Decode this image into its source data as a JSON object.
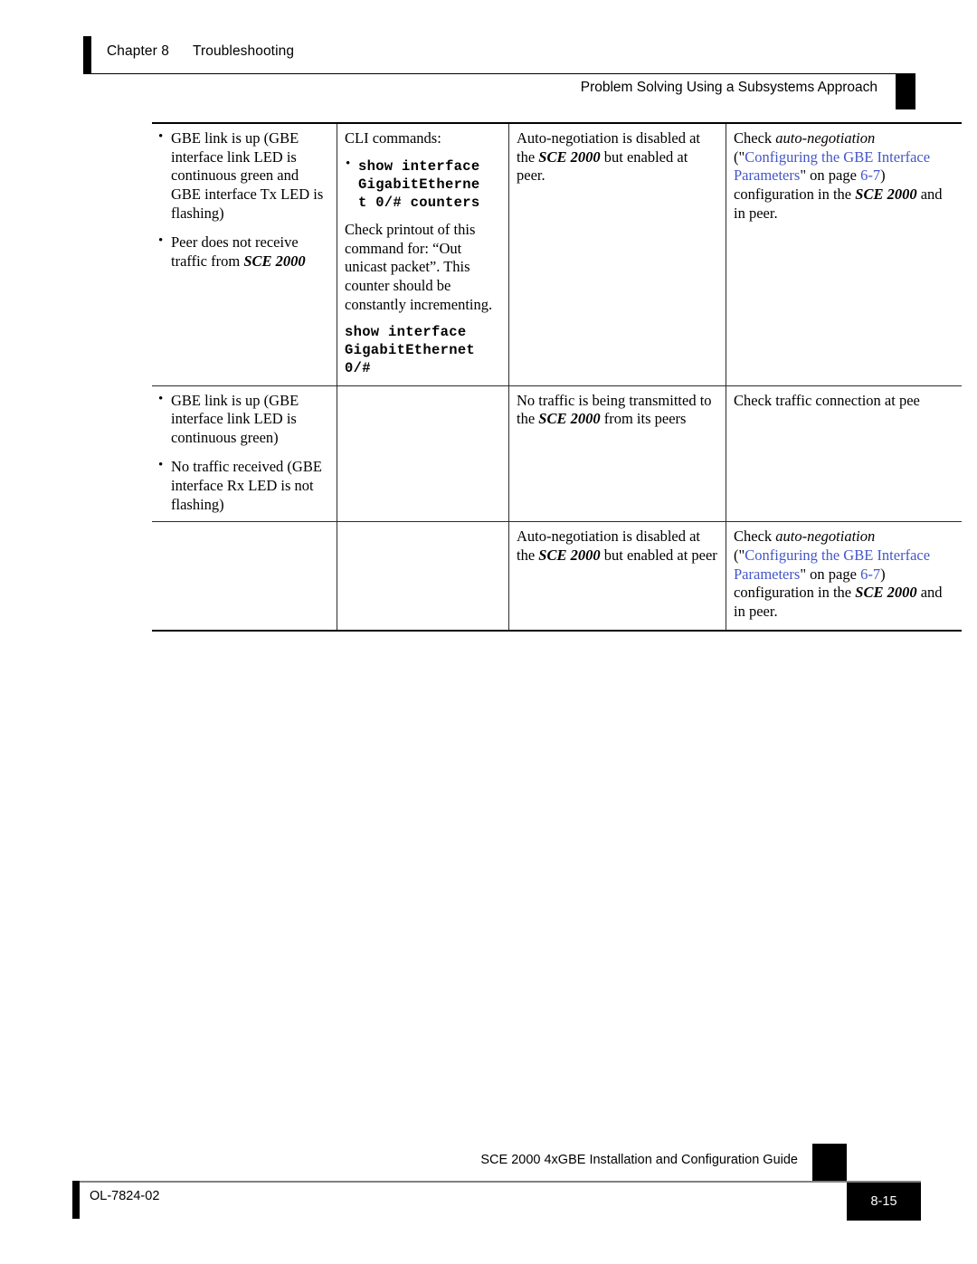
{
  "header": {
    "chapter_label": "Chapter 8",
    "chapter_title": "Troubleshooting",
    "section_title": "Problem Solving Using a Subsystems Approach"
  },
  "table": {
    "rows": [
      {
        "symptom_bullets": [
          "GBE link is up (GBE interface link LED is continuous green and GBE interface Tx LED is flashing)",
          "Peer does not receive traffic from SCE 2000"
        ],
        "symptom_bullet2_plain": "Peer does not receive traffic from ",
        "symptom_bullet2_emph": "SCE 2000",
        "check_intro": "CLI commands:",
        "check_cmd_bullet_l1": "show interface",
        "check_cmd_bullet_l2": "GigabitEtherne",
        "check_cmd_bullet_l3": "t 0/# counters",
        "check_paragraph": "Check printout of this command for: “Out unicast packet”. This counter should be constantly incrementing.",
        "check_cmd2_l1": "show interface",
        "check_cmd2_l2": "GigabitEthernet",
        "check_cmd2_l3": "0/#",
        "problem_pre": "Auto-negotiation is disabled at the ",
        "problem_emph": "SCE 2000",
        "problem_post": " but enabled at peer.",
        "solution_pre": "Check ",
        "solution_italic": "auto-negotiation",
        "solution_open": " (\"",
        "solution_link1": "Configuring the GBE",
        "solution_link2": "Interface Parameters",
        "solution_close": "\" on page ",
        "solution_pagelink": "6-7",
        "solution_tail_pre": ") configuration in the ",
        "solution_tail_emph": "SCE 2000",
        "solution_tail_post": " and in peer."
      },
      {
        "symptom_bullets": [
          "GBE link is up (GBE interface link LED is continuous green)",
          "No traffic received (GBE interface Rx LED is not flashing)"
        ],
        "check_text": "",
        "problem_pre": "No traffic is being transmitted to the ",
        "problem_emph": "SCE 2000",
        "problem_post": " from its peers",
        "solution_text": "Check traffic connection at pee"
      },
      {
        "symptom_text": "",
        "check_text": "",
        "problem_pre": "Auto-negotiation is disabled at the ",
        "problem_emph": "SCE 2000",
        "problem_post": " but enabled at peer",
        "solution_pre": "Check ",
        "solution_italic": "auto-negotiation",
        "solution_open": " (\"",
        "solution_link1": "Configuring the GBE",
        "solution_link2": "Interface Parameters",
        "solution_close": "\" on page ",
        "solution_pagelink": "6-7",
        "solution_tail_pre": ") configuration in the ",
        "solution_tail_emph": "SCE 2000",
        "solution_tail_post": " and in peer."
      }
    ]
  },
  "footer": {
    "doc_title": "SCE 2000 4xGBE Installation and Configuration Guide",
    "doc_number": "OL-7824-02",
    "page_number": "8-15"
  },
  "colors": {
    "link": "#4357c8",
    "rule": "#808080",
    "ink": "#000000"
  }
}
